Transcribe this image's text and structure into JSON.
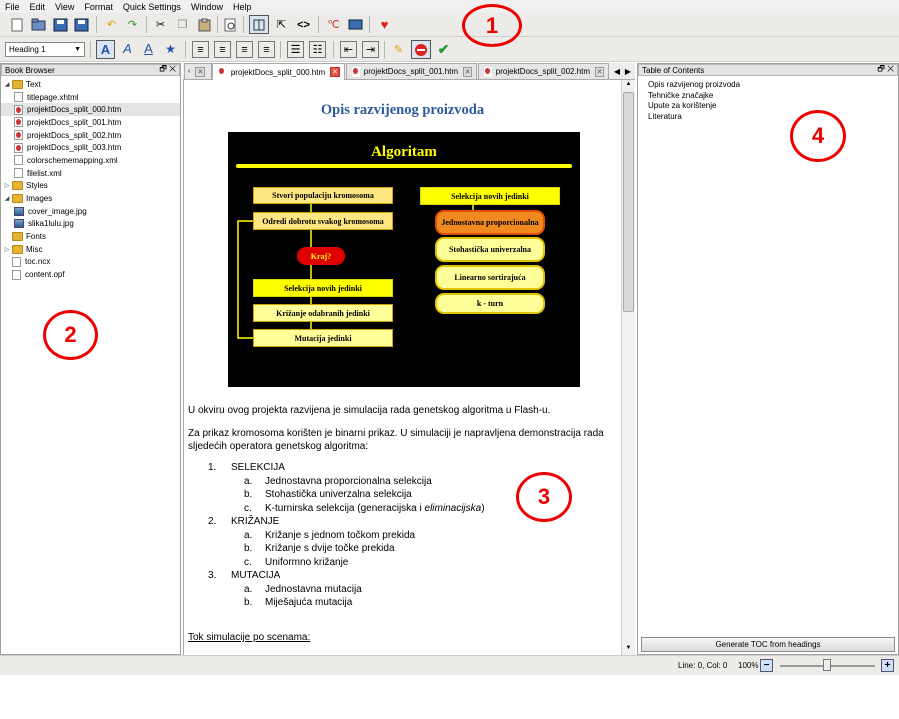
{
  "menu": [
    "File",
    "Edit",
    "View",
    "Format",
    "Quick Settings",
    "Window",
    "Help"
  ],
  "toolbar": {
    "heading_select": "Heading 1",
    "annotation": "1"
  },
  "book_browser": {
    "title": "Book Browser",
    "annotation": "2",
    "items": [
      {
        "label": "Text",
        "type": "folder",
        "expanded": true,
        "level": 0
      },
      {
        "label": "titlepage.xhtml",
        "type": "doc",
        "level": 1
      },
      {
        "label": "projektDocs_split_000.htm",
        "type": "htm",
        "level": 1,
        "selected": true
      },
      {
        "label": "projektDocs_split_001.htm",
        "type": "htm",
        "level": 1
      },
      {
        "label": "projektDocs_split_002.htm",
        "type": "htm",
        "level": 1
      },
      {
        "label": "projektDocs_split_003.htm",
        "type": "htm",
        "level": 1
      },
      {
        "label": "colorschememapping.xml",
        "type": "doc",
        "level": 1
      },
      {
        "label": "filelist.xml",
        "type": "doc",
        "level": 1
      },
      {
        "label": "Styles",
        "type": "folder",
        "expanded": false,
        "level": 0
      },
      {
        "label": "Images",
        "type": "folder",
        "expanded": true,
        "level": 0
      },
      {
        "label": "cover_image.jpg",
        "type": "img",
        "level": 1
      },
      {
        "label": "slika1lulu.jpg",
        "type": "img",
        "level": 1
      },
      {
        "label": "Fonts",
        "type": "folder",
        "level": 0
      },
      {
        "label": "Misc",
        "type": "folder",
        "expanded": false,
        "level": 0
      },
      {
        "label": "toc.ncx",
        "type": "doc",
        "level": 0
      },
      {
        "label": "content.opf",
        "type": "doc",
        "level": 0
      }
    ]
  },
  "tabs": [
    {
      "label": "projektDocs_split_000.htm",
      "active": true
    },
    {
      "label": "projektDocs_split_001.htm",
      "active": false
    },
    {
      "label": "projektDocs_split_002.htm",
      "active": false
    }
  ],
  "document": {
    "title": "Opis razvijenog proizvoda",
    "annotation": "3",
    "figure": {
      "title": "Algoritam",
      "left_boxes": [
        "Stvori populaciju kromosoma",
        "Odredi dobrotu svakog kromosoma",
        "Kraj?",
        "Selekcija novih jedinki",
        "Križanje odabranih jedinki",
        "Mutacija jedinki"
      ],
      "right_title": "Selekcija novih jedinki",
      "right_pills": [
        "Jednostavna proporcionalna",
        "Stohastička univerzalna",
        "Linearno sortirajuća",
        "k - turn"
      ]
    },
    "para1": "U okviru ovog projekta razvijena je simulacija rada genetskog algoritma u Flash-u.",
    "para2": "Za prikaz kromosoma korišten je binarni prikaz. U simulaciji je napravljena demonstracija rada sljedećih operatora genetskog algoritma:",
    "list": [
      {
        "num": "1.",
        "label": "SELEKCIJA",
        "sub": [
          {
            "num": "a.",
            "label": "Jednostavna proporcionalna selekcija"
          },
          {
            "num": "b.",
            "label": "Stohastička univerzalna selekcija"
          },
          {
            "num": "c.",
            "label": "K-turnirska selekcija (generacijska i ",
            "italic": "eliminacijska",
            "after": ")"
          }
        ]
      },
      {
        "num": "2.",
        "label": "KRIŽANJE",
        "sub": [
          {
            "num": "a.",
            "label": "Križanje s jednom točkom prekida"
          },
          {
            "num": "b.",
            "label": "Križanje s dvije točke prekida"
          },
          {
            "num": "c.",
            "label": "Uniformno križanje"
          }
        ]
      },
      {
        "num": "3.",
        "label": "MUTACIJA",
        "sub": [
          {
            "num": "a.",
            "label": "Jednostavna mutacija"
          },
          {
            "num": "b.",
            "label": "Miješajuća mutacija"
          }
        ]
      }
    ],
    "footer_heading": "Tok simulacije po scenama:"
  },
  "toc": {
    "title": "Table of Contents",
    "annotation": "4",
    "items": [
      "Opis razvijenog proizvoda",
      "Tehničke značajke",
      "Upute za korištenje",
      "Literatura"
    ],
    "generate_button": "Generate TOC from headings"
  },
  "status": {
    "position": "Line: 0, Col: 0",
    "zoom": "100%"
  }
}
